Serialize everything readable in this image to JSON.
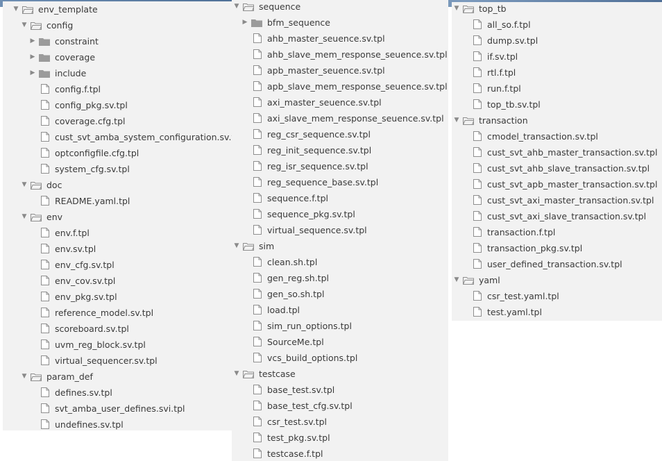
{
  "panels": [
    {
      "items": [
        {
          "label": "env_template",
          "kind": "folder",
          "expanded": true,
          "depth": 0
        },
        {
          "label": "config",
          "kind": "folder",
          "expanded": true,
          "depth": 1
        },
        {
          "label": "constraint",
          "kind": "folder",
          "expanded": false,
          "depth": 2
        },
        {
          "label": "coverage",
          "kind": "folder",
          "expanded": false,
          "depth": 2
        },
        {
          "label": "include",
          "kind": "folder",
          "expanded": false,
          "depth": 2
        },
        {
          "label": "config.f.tpl",
          "kind": "file",
          "depth": 2
        },
        {
          "label": "config_pkg.sv.tpl",
          "kind": "file",
          "depth": 2
        },
        {
          "label": "coverage.cfg.tpl",
          "kind": "file",
          "depth": 2
        },
        {
          "label": "cust_svt_amba_system_configuration.sv.tpl",
          "kind": "file",
          "depth": 2
        },
        {
          "label": "optconfigfile.cfg.tpl",
          "kind": "file",
          "depth": 2
        },
        {
          "label": "system_cfg.sv.tpl",
          "kind": "file",
          "depth": 2
        },
        {
          "label": "doc",
          "kind": "folder",
          "expanded": true,
          "depth": 1
        },
        {
          "label": "README.yaml.tpl",
          "kind": "file",
          "depth": 2
        },
        {
          "label": "env",
          "kind": "folder",
          "expanded": true,
          "depth": 1
        },
        {
          "label": "env.f.tpl",
          "kind": "file",
          "depth": 2
        },
        {
          "label": "env.sv.tpl",
          "kind": "file",
          "depth": 2
        },
        {
          "label": "env_cfg.sv.tpl",
          "kind": "file",
          "depth": 2
        },
        {
          "label": "env_cov.sv.tpl",
          "kind": "file",
          "depth": 2
        },
        {
          "label": "env_pkg.sv.tpl",
          "kind": "file",
          "depth": 2
        },
        {
          "label": "reference_model.sv.tpl",
          "kind": "file",
          "depth": 2
        },
        {
          "label": "scoreboard.sv.tpl",
          "kind": "file",
          "depth": 2
        },
        {
          "label": "uvm_reg_block.sv.tpl",
          "kind": "file",
          "depth": 2
        },
        {
          "label": "virtual_sequencer.sv.tpl",
          "kind": "file",
          "depth": 2
        },
        {
          "label": "param_def",
          "kind": "folder",
          "expanded": true,
          "depth": 1
        },
        {
          "label": "defines.sv.tpl",
          "kind": "file",
          "depth": 2
        },
        {
          "label": "svt_amba_user_defines.svi.tpl",
          "kind": "file",
          "depth": 2
        },
        {
          "label": "undefines.sv.tpl",
          "kind": "file",
          "depth": 2
        }
      ]
    },
    {
      "items": [
        {
          "label": "sequence",
          "kind": "folder",
          "expanded": true,
          "depth": 0
        },
        {
          "label": "bfm_sequence",
          "kind": "folder",
          "expanded": false,
          "depth": 1
        },
        {
          "label": "ahb_master_seuence.sv.tpl",
          "kind": "file",
          "depth": 1
        },
        {
          "label": "ahb_slave_mem_response_seuence.sv.tpl",
          "kind": "file",
          "depth": 1
        },
        {
          "label": "apb_master_seuence.sv.tpl",
          "kind": "file",
          "depth": 1
        },
        {
          "label": "apb_slave_mem_response_seuence.sv.tpl",
          "kind": "file",
          "depth": 1
        },
        {
          "label": "axi_master_seuence.sv.tpl",
          "kind": "file",
          "depth": 1
        },
        {
          "label": "axi_slave_mem_response_seuence.sv.tpl",
          "kind": "file",
          "depth": 1
        },
        {
          "label": "reg_csr_sequence.sv.tpl",
          "kind": "file",
          "depth": 1
        },
        {
          "label": "reg_init_sequence.sv.tpl",
          "kind": "file",
          "depth": 1
        },
        {
          "label": "reg_isr_sequence.sv.tpl",
          "kind": "file",
          "depth": 1
        },
        {
          "label": "reg_sequence_base.sv.tpl",
          "kind": "file",
          "depth": 1
        },
        {
          "label": "sequence.f.tpl",
          "kind": "file",
          "depth": 1
        },
        {
          "label": "sequence_pkg.sv.tpl",
          "kind": "file",
          "depth": 1
        },
        {
          "label": "virtual_sequence.sv.tpl",
          "kind": "file",
          "depth": 1
        },
        {
          "label": "sim",
          "kind": "folder",
          "expanded": true,
          "depth": 0
        },
        {
          "label": "clean.sh.tpl",
          "kind": "file",
          "depth": 1
        },
        {
          "label": "gen_reg.sh.tpl",
          "kind": "file",
          "depth": 1
        },
        {
          "label": "gen_so.sh.tpl",
          "kind": "file",
          "depth": 1
        },
        {
          "label": "load.tpl",
          "kind": "file",
          "depth": 1
        },
        {
          "label": "sim_run_options.tpl",
          "kind": "file",
          "depth": 1
        },
        {
          "label": "SourceMe.tpl",
          "kind": "file",
          "depth": 1
        },
        {
          "label": "vcs_build_options.tpl",
          "kind": "file",
          "depth": 1
        },
        {
          "label": "testcase",
          "kind": "folder",
          "expanded": true,
          "depth": 0
        },
        {
          "label": "base_test.sv.tpl",
          "kind": "file",
          "depth": 1
        },
        {
          "label": "base_test_cfg.sv.tpl",
          "kind": "file",
          "depth": 1
        },
        {
          "label": "csr_test.sv.tpl",
          "kind": "file",
          "depth": 1
        },
        {
          "label": "test_pkg.sv.tpl",
          "kind": "file",
          "depth": 1
        },
        {
          "label": "testcase.f.tpl",
          "kind": "file",
          "depth": 1
        }
      ]
    },
    {
      "items": [
        {
          "label": "top_tb",
          "kind": "folder",
          "expanded": true,
          "depth": 0
        },
        {
          "label": "all_so.f.tpl",
          "kind": "file",
          "depth": 1
        },
        {
          "label": "dump.sv.tpl",
          "kind": "file",
          "depth": 1
        },
        {
          "label": "if.sv.tpl",
          "kind": "file",
          "depth": 1
        },
        {
          "label": "rtl.f.tpl",
          "kind": "file",
          "depth": 1
        },
        {
          "label": "run.f.tpl",
          "kind": "file",
          "depth": 1
        },
        {
          "label": "top_tb.sv.tpl",
          "kind": "file",
          "depth": 1
        },
        {
          "label": "transaction",
          "kind": "folder",
          "expanded": true,
          "depth": 0
        },
        {
          "label": "cmodel_transaction.sv.tpl",
          "kind": "file",
          "depth": 1
        },
        {
          "label": "cust_svt_ahb_master_transaction.sv.tpl",
          "kind": "file",
          "depth": 1
        },
        {
          "label": "cust_svt_ahb_slave_transaction.sv.tpl",
          "kind": "file",
          "depth": 1
        },
        {
          "label": "cust_svt_apb_master_transaction.sv.tpl",
          "kind": "file",
          "depth": 1
        },
        {
          "label": "cust_svt_axi_master_transaction.sv.tpl",
          "kind": "file",
          "depth": 1
        },
        {
          "label": "cust_svt_axi_slave_transaction.sv.tpl",
          "kind": "file",
          "depth": 1
        },
        {
          "label": "transaction.f.tpl",
          "kind": "file",
          "depth": 1
        },
        {
          "label": "transaction_pkg.sv.tpl",
          "kind": "file",
          "depth": 1
        },
        {
          "label": "user_defined_transaction.sv.tpl",
          "kind": "file",
          "depth": 1
        },
        {
          "label": "yaml",
          "kind": "folder",
          "expanded": true,
          "depth": 0
        },
        {
          "label": "csr_test.yaml.tpl",
          "kind": "file",
          "depth": 1
        },
        {
          "label": "test.yaml.tpl",
          "kind": "file",
          "depth": 1
        }
      ]
    }
  ],
  "colors": {
    "panel_bg": "#f2f2f2",
    "folder": "#9b9b9b",
    "file_stroke": "#8e8e8e",
    "text": "#3a3a3a"
  }
}
